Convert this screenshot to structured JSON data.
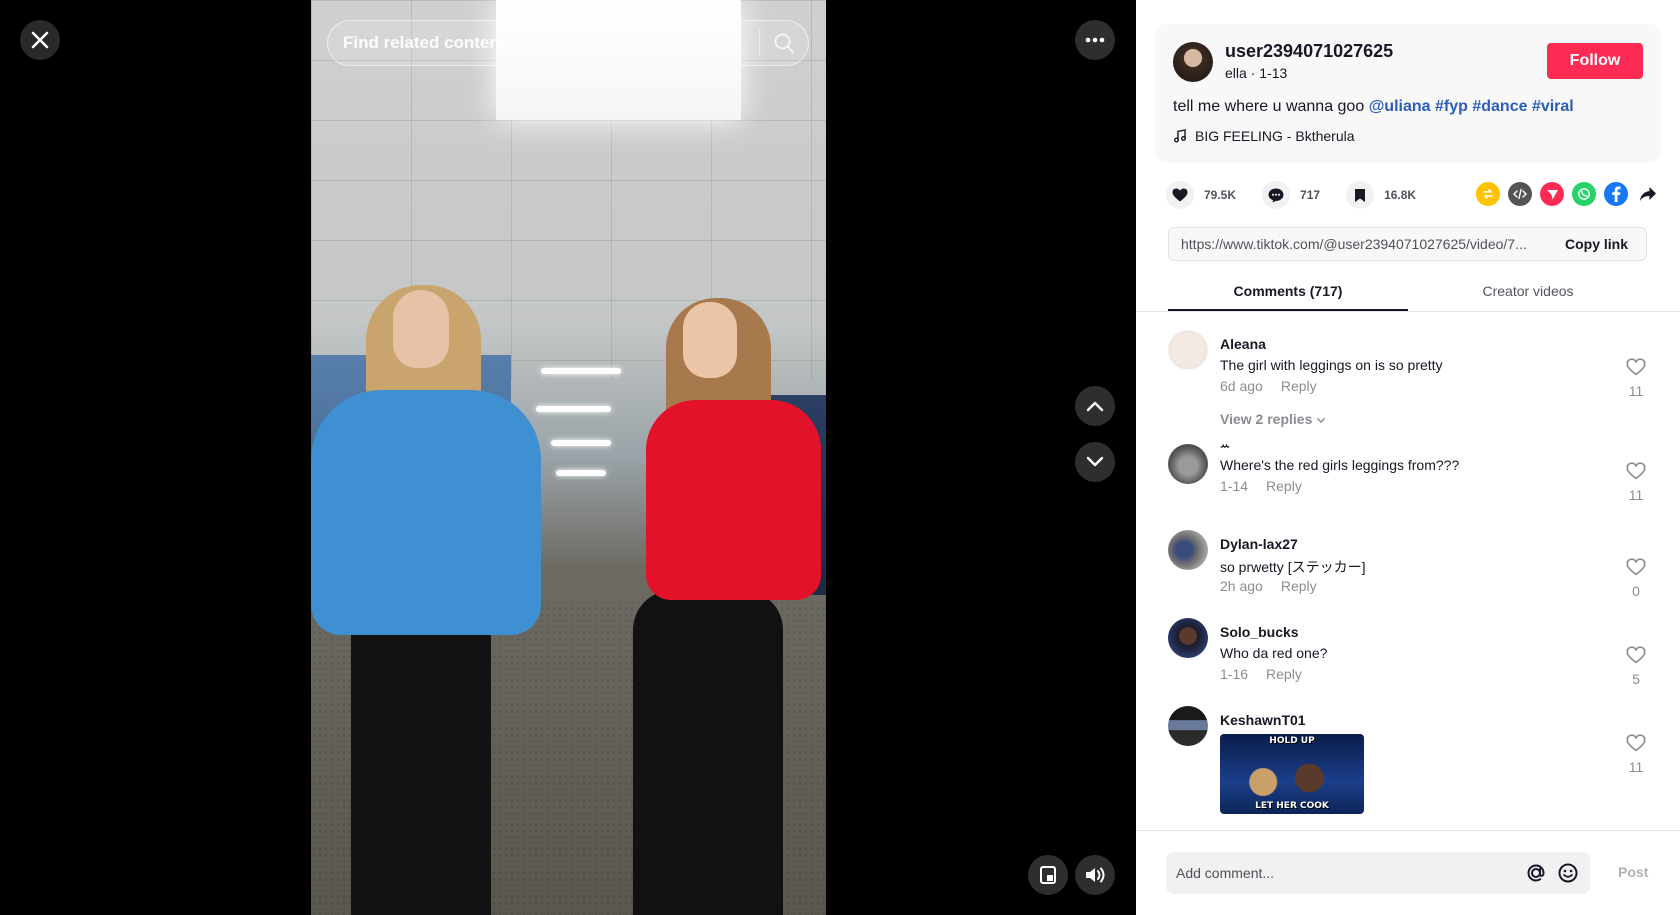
{
  "colors": {
    "accent": "#fe2c55",
    "hashtag": "#2b5db9",
    "text": "#161823"
  },
  "video": {
    "search_placeholder": "Find related content",
    "icons": [
      "close-icon",
      "search-icon",
      "more-icon",
      "chevron-up-icon",
      "chevron-down-icon",
      "mini-player-icon",
      "volume-icon"
    ]
  },
  "author": {
    "username": "user2394071027625",
    "nickname": "ella",
    "date": "1-13",
    "follow_label": "Follow"
  },
  "caption": {
    "text": "tell me where u wanna goo",
    "mention": "@uliana",
    "hashtags": [
      "#fyp",
      "#dance",
      "#viral"
    ]
  },
  "music": {
    "title": "BIG FEELING - Bktherula"
  },
  "actions": {
    "likes": "79.5K",
    "comments": "717",
    "saves": "16.8K"
  },
  "share_targets": [
    "repost",
    "embed",
    "send-to-friends",
    "whatsapp",
    "facebook",
    "share"
  ],
  "link": {
    "url": "https://www.tiktok.com/@user2394071027625/video/7...",
    "copy_label": "Copy link"
  },
  "tabs": {
    "comments": "Comments (717)",
    "creator_videos": "Creator videos"
  },
  "comments": [
    {
      "name": "Aleana",
      "text": "The girl with leggings on is so pretty",
      "time": "6d ago",
      "reply": "Reply",
      "likes": "11",
      "view_replies": "View 2 replies"
    },
    {
      "name": "ꕀ",
      "text": "Where's the red girls leggings from???",
      "time": "1-14",
      "reply": "Reply",
      "likes": "11"
    },
    {
      "name": "Dylan-lax27",
      "text": "so prwetty [ステッカー]",
      "time": "2h ago",
      "reply": "Reply",
      "likes": "0"
    },
    {
      "name": "Solo_bucks",
      "text": "Who da red one?",
      "time": "1-16",
      "reply": "Reply",
      "likes": "5"
    },
    {
      "name": "KeshawnT01",
      "gif_top": "HOLD UP",
      "gif_bottom": "LET HER COOK",
      "likes": "11"
    }
  ],
  "composer": {
    "placeholder": "Add comment...",
    "post_label": "Post"
  }
}
